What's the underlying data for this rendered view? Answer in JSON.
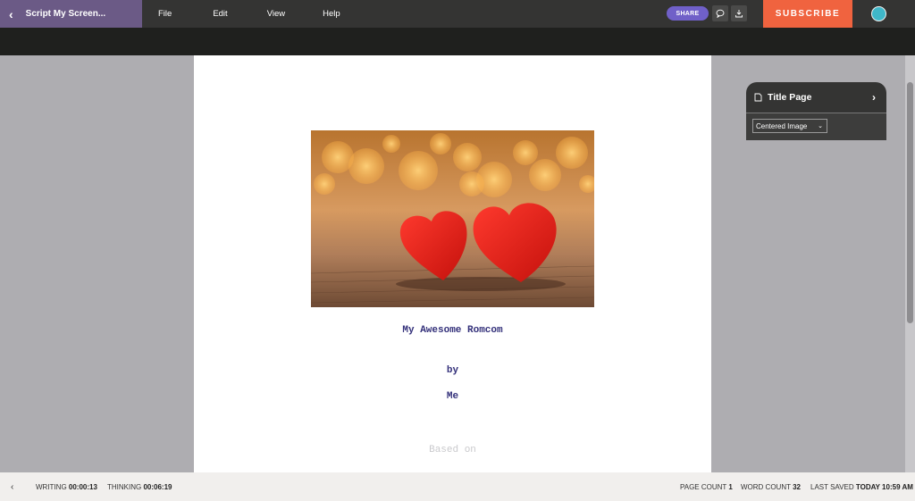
{
  "topbar": {
    "doc_title": "Script My Screen...",
    "menu": [
      "File",
      "Edit",
      "View",
      "Help"
    ],
    "share_label": "SHARE",
    "subscribe_label": "SUBSCRIBE",
    "colors": {
      "accent": "#6b5a86",
      "share": "#7060c8",
      "subscribe": "#f0633f",
      "avatar": "#3fb7c9"
    }
  },
  "page": {
    "image": "hearts-photo",
    "title": "My Awesome Romcom",
    "by": "by",
    "author": "Me",
    "based_on": "Based on"
  },
  "panel": {
    "heading": "Title Page",
    "layout_select": "Centered Image"
  },
  "status": {
    "writing_label": "WRITING",
    "writing_value": "00:00:13",
    "thinking_label": "THINKING",
    "thinking_value": "00:06:19",
    "page_count_label": "PAGE COUNT",
    "page_count_value": "1",
    "word_count_label": "WORD COUNT",
    "word_count_value": "32",
    "last_saved_label": "LAST SAVED",
    "last_saved_value": "TODAY 10:59 AM"
  }
}
